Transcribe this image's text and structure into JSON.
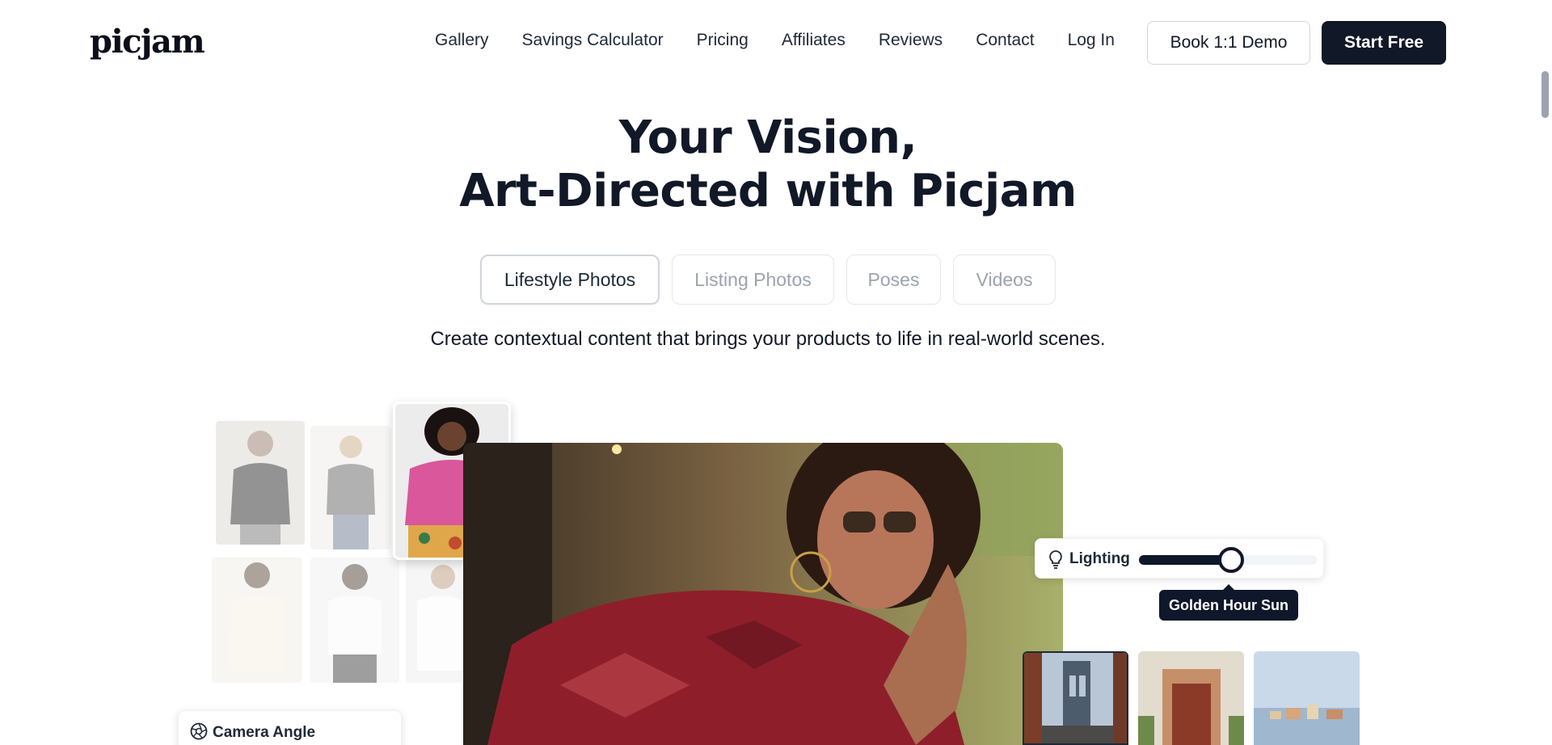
{
  "brand": {
    "logo_text": "picjam"
  },
  "nav": {
    "items": [
      "Gallery",
      "Savings Calculator",
      "Pricing",
      "Affiliates",
      "Reviews",
      "Contact",
      "Log In"
    ],
    "demo_button": "Book 1:1 Demo",
    "start_button": "Start Free"
  },
  "hero": {
    "title_line1": "Your Vision,",
    "title_line2": "Art-Directed with Picjam",
    "tabs": [
      {
        "label": "Lifestyle Photos",
        "active": true
      },
      {
        "label": "Listing Photos",
        "active": false
      },
      {
        "label": "Poses",
        "active": false
      },
      {
        "label": "Videos",
        "active": false
      }
    ],
    "tagline": "Create contextual content that brings your products to life in real-world scenes."
  },
  "controls": {
    "lighting_label": "Lighting",
    "lighting_level": 0.5,
    "lighting_value": "Golden Hour Sun",
    "camera_label": "Camera Angle"
  },
  "icons": {
    "lighting": "lightbulb-icon",
    "camera": "aperture-icon"
  },
  "colors": {
    "primary": "#111827",
    "muted_text": "#9ca3af",
    "border": "#e5e7eb"
  }
}
